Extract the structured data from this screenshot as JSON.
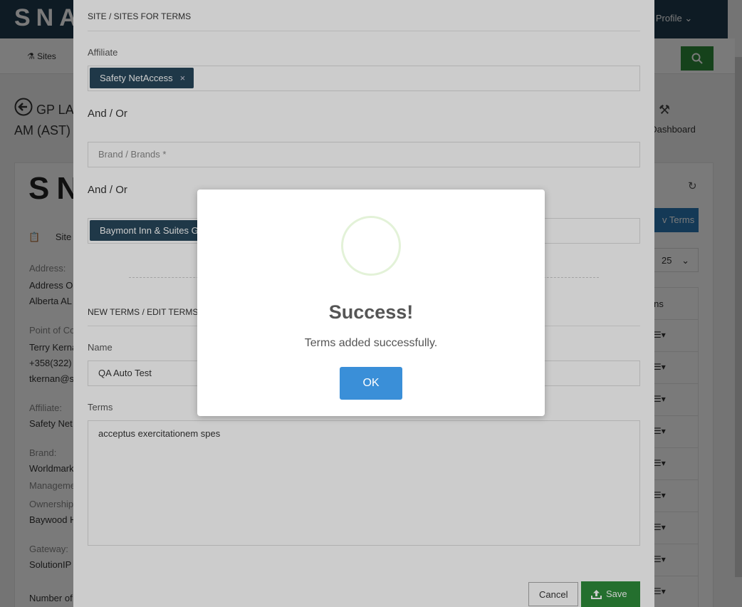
{
  "topbar": {
    "logo": "SNA",
    "profile": "n Profile"
  },
  "nav": {
    "sites": "Sites"
  },
  "page": {
    "title_line1": "GP LA",
    "title_line2": "AM (AST)",
    "dashboard_link": "t Dashboard",
    "card_logo": "SN",
    "new_terms_button": "v Terms",
    "per_page": "25",
    "site_tab": "Site",
    "fields": [
      {
        "label": "Address:",
        "values": [
          "Address O",
          "Alberta AL"
        ]
      },
      {
        "label": "Point of Co",
        "values": [
          "Terry Kerna",
          "+358(322)",
          "tkernan@s"
        ]
      },
      {
        "label": "Affiliate:",
        "values": [
          "Safety Net"
        ]
      },
      {
        "label": "Brand:",
        "values": [
          "Worldmark"
        ]
      },
      {
        "label": "Manageme",
        "values": []
      },
      {
        "label": "Ownership",
        "values": [
          "Baywood H"
        ]
      },
      {
        "label": "Gateway:",
        "values": [
          "SolutionIP"
        ]
      },
      {
        "label": "Number of",
        "values": []
      }
    ],
    "table_header": "ions",
    "table_rows": 9
  },
  "modal": {
    "title": "SITE / SITES FOR TERMS",
    "affiliate_label": "Affiliate",
    "affiliate_chip": "Safety NetAccess",
    "chip_remove": "×",
    "and_or_1": "And / Or",
    "brand_placeholder": "Brand / Brands *",
    "and_or_2": "And / Or",
    "site_chip": "Baymont Inn & Suites G",
    "section_title": "NEW TERMS / EDIT TERMS",
    "name_label": "Name",
    "name_value": "QA Auto Test",
    "terms_label": "Terms",
    "terms_value": "acceptus exercitationem spes",
    "cancel_label": "Cancel",
    "save_label": "Save"
  },
  "dialog": {
    "title": "Success!",
    "message": "Terms added successfully.",
    "ok_label": "OK"
  },
  "colors": {
    "topbar": "#1f3a4d",
    "chip": "#27475a",
    "save": "#2e8b3a",
    "ok": "#3a8fd8",
    "success_ring": "#e3f2d8"
  }
}
